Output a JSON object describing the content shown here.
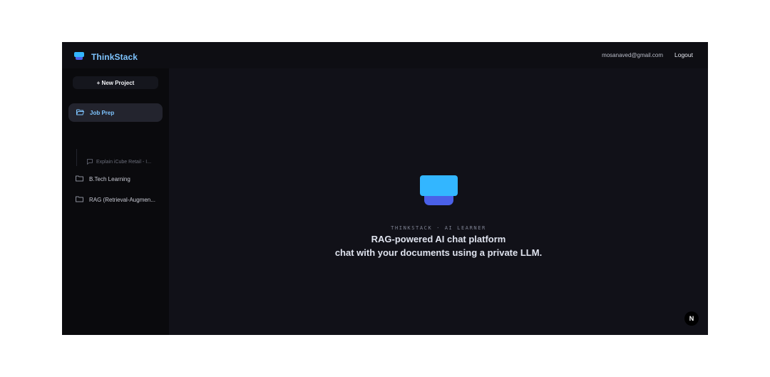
{
  "header": {
    "app_title": "ThinkStack",
    "user_email": "mosanaved@gmail.com",
    "logout_label": "Logout"
  },
  "sidebar": {
    "new_project_label": "+ New Project",
    "items": [
      {
        "label": "Job Prep",
        "icon": "folder-open-icon",
        "active": true,
        "children": [
          {
            "label": "Explain iCube Retail - I...",
            "icon": "chat-bubble-icon"
          }
        ]
      },
      {
        "label": "B.Tech Learning",
        "icon": "folder-icon",
        "active": false
      },
      {
        "label": "RAG (Retrieval-Augmen...",
        "icon": "folder-icon",
        "active": false
      }
    ]
  },
  "main": {
    "tagline": "THINKSTACK · AI LEARNER",
    "headline_line1": "RAG-powered AI chat platform",
    "headline_line2": "chat with your documents using a private LLM."
  },
  "badge": {
    "label": "N"
  },
  "colors": {
    "accent": "#7ec4ff",
    "logo_top": "#33b6ff",
    "logo_bottom": "#4a60e8",
    "app_bg": "#111118",
    "sidebar_bg": "#0a0a0d"
  }
}
